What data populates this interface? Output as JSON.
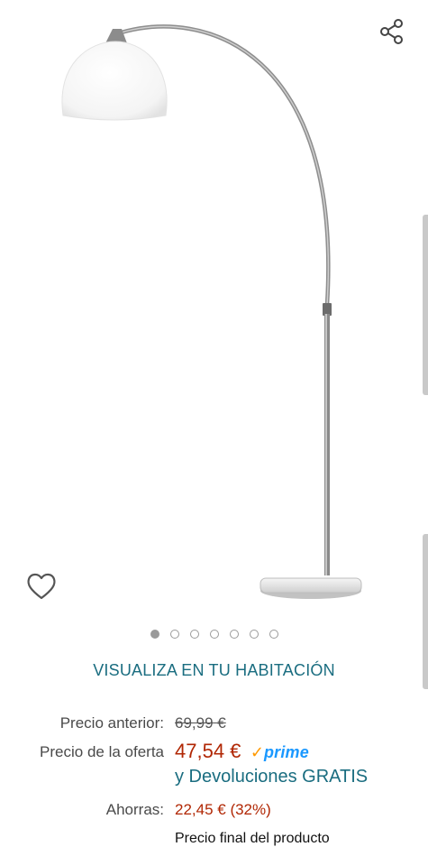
{
  "product_image": {
    "alt": ""
  },
  "carousel": {
    "total": 7,
    "active_index": 0
  },
  "ar_link": {
    "label": "VISUALIZA EN TU HABITACIÓN"
  },
  "pricing": {
    "previous_label": "Precio anterior:",
    "previous_value": "69,99 €",
    "offer_label": "Precio de la oferta",
    "offer_value": "47,54 €",
    "prime_check": "✓",
    "prime_word": "prime",
    "returns_text": "y Devoluciones GRATIS",
    "savings_label": "Ahorras:",
    "savings_value": "22,45 € (32%)",
    "final_note": "Precio final del producto"
  },
  "icons": {
    "share": "share-icon",
    "wishlist": "heart-icon"
  },
  "colors": {
    "offer": "#b12704",
    "link": "#1a6d80",
    "prime_blue": "#1a98ff",
    "prime_check": "#ff9900"
  }
}
